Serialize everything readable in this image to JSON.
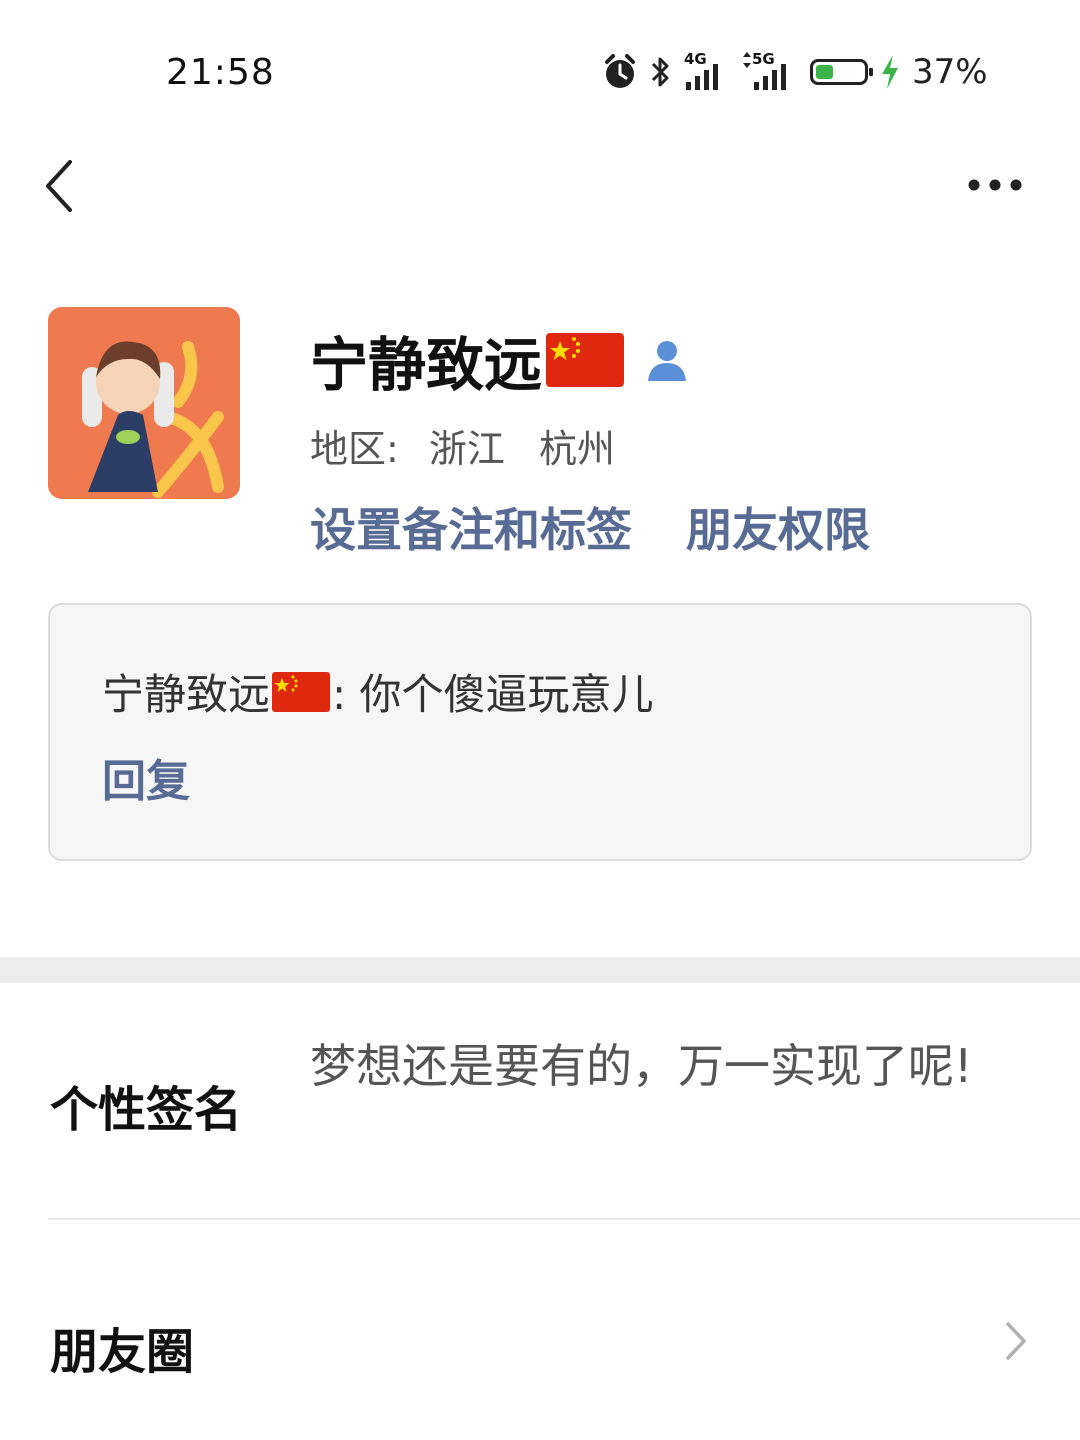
{
  "status_bar": {
    "time": "21:58",
    "network_1": "4G",
    "network_2": "5G",
    "battery_percent_text": "37%",
    "battery_level": 0.37,
    "icons": [
      "alarm-icon",
      "bluetooth-icon",
      "signal-4g-icon",
      "signal-5g-icon",
      "battery-icon",
      "charging-icon"
    ]
  },
  "nav": {
    "back_icon": "chevron-left-icon",
    "more_icon": "more-icon"
  },
  "profile": {
    "name": "宁静致远",
    "region_label": "地区:",
    "region_province": "浙江",
    "region_city": "杭州",
    "set_remark_label": "设置备注和标签",
    "friend_permission_label": "朋友权限"
  },
  "message": {
    "sender": "宁静致远",
    "content": ": 你个傻逼玩意儿",
    "reply_label": "回复"
  },
  "signature": {
    "label": "个性签名",
    "text": "梦想还是要有的，万一实现了呢!"
  },
  "moments": {
    "label": "朋友圈"
  },
  "colors": {
    "link": "#576b95",
    "avatar_bg": "#ef7a4f",
    "flag_red": "#de2910",
    "flag_star": "#ffde00",
    "battery_fill": "#3bb54a",
    "charging_bolt": "#3bb54a",
    "contact_icon": "#5b8fd8"
  }
}
